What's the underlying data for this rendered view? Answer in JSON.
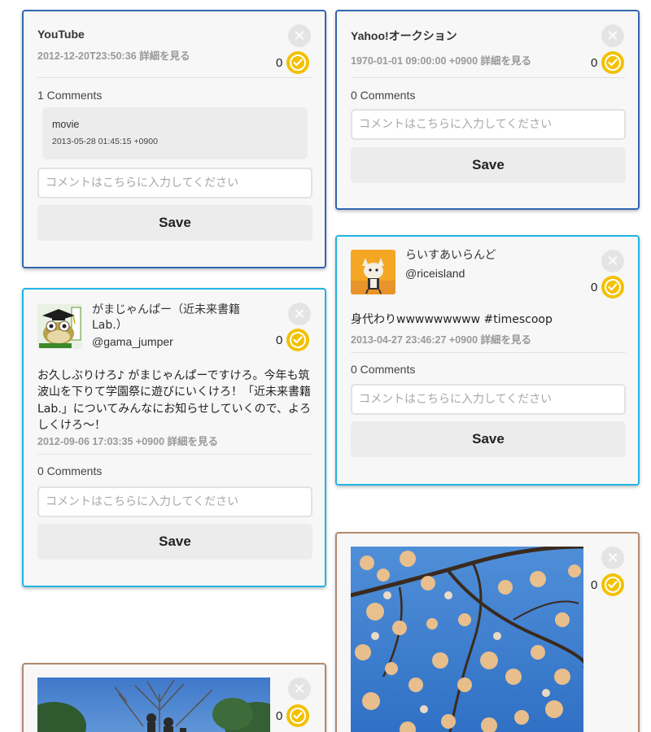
{
  "placeholder": "コメントはこちらに入力してください",
  "save_label": "Save",
  "close_glyph": "✕",
  "detail_link": "詳細を見る",
  "card_youtube": {
    "title": "YouTube",
    "timestamp": "2012-12-20T23:50:36",
    "count": "0",
    "comments_label": "1 Comments",
    "comment": {
      "text": "movie",
      "time": "2013-05-28 01:45:15 +0900"
    }
  },
  "card_yahoo": {
    "title": "Yahoo!オークション",
    "timestamp": "1970-01-01 09:00:00 +0900",
    "count": "0",
    "comments_label": "0 Comments"
  },
  "card_gama": {
    "name": "がまじゃんぱー（近未来書籍Lab.）",
    "handle": "@gama_jumper",
    "count": "0",
    "body": "お久しぶりけろ♪ がまじゃんぱーですけろ。今年も筑波山を下りて学園祭に遊びにいくけろ！「近未来書籍Lab.」についてみんなにお知らせしていくので、よろしくけろ〜！",
    "timestamp": "2012-09-06 17:03:35 +0900",
    "comments_label": "0 Comments"
  },
  "card_rice": {
    "name": "らいすあいらんど",
    "handle": "@riceisland",
    "count": "0",
    "body": "身代わりwwwwwwwww #timescoop",
    "timestamp": "2013-04-27 23:46:27 +0900",
    "comments_label": "0 Comments"
  },
  "card_photo_blossom": {
    "count": "0"
  },
  "card_photo_statue": {
    "count": "0"
  },
  "colors": {
    "blue_border": "#3366b0",
    "cyan_border": "#22b5e3",
    "brown_border": "#b08a70",
    "check_yellow": "#f2c100"
  }
}
